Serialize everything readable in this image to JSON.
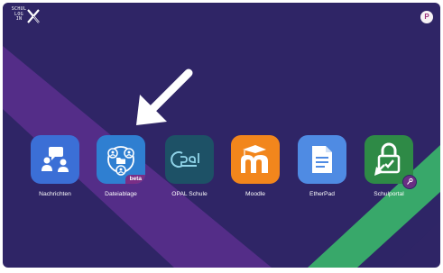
{
  "logo": {
    "text_lines": [
      "SCHUL",
      "LOG",
      "IN"
    ]
  },
  "user": {
    "initial": "P"
  },
  "apps": [
    {
      "label": "Nachrichten",
      "color": "#3b6fd6",
      "icon": "chat-people-icon"
    },
    {
      "label": "Dateiablage",
      "color": "#2f7fd1",
      "icon": "network-folder-icon",
      "badge": "beta"
    },
    {
      "label": "OPAL Schule",
      "color": "#1d5166",
      "icon": "opal-logo-icon"
    },
    {
      "label": "Moodle",
      "color": "#f2861c",
      "icon": "moodle-logo-icon"
    },
    {
      "label": "EtherPad",
      "color": "#4f8be3",
      "icon": "document-icon"
    },
    {
      "label": "Schulportal",
      "color": "#2e8a46",
      "icon": "lock-key-icon"
    }
  ],
  "colors": {
    "background": "#2f2566",
    "purple_band": "#5b2f8e",
    "green_band": "#38a86a",
    "arrow": "#ffffff"
  }
}
